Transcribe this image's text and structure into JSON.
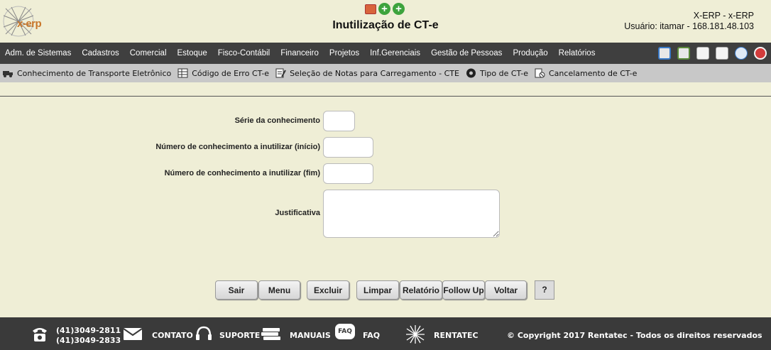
{
  "header": {
    "logo_text": "x-erp",
    "title": "Inutilização de CT-e",
    "system": "X-ERP - x-ERP",
    "user": "Usuário: itamar - 168.181.48.103"
  },
  "main_menu": [
    "Adm. de Sistemas",
    "Cadastros",
    "Comercial",
    "Estoque",
    "Fisco-Contábil",
    "Financeiro",
    "Projetos",
    "Inf.Gerenciais",
    "Gestão de Pessoas",
    "Produção",
    "Relatórios"
  ],
  "sub_menu": [
    "Conhecimento de Transporte Eletrônico",
    "Código de Erro CT-e",
    "Seleção de Notas para Carregamento - CTE",
    "Tipo de CT-e",
    "Cancelamento de CT-e"
  ],
  "form": {
    "serie_label": "Série da conhecimento",
    "numero_inicio_label": "Número de conhecimento a inutilizar (início)",
    "numero_fim_label": "Número de conhecimento a inutilizar (fim)",
    "justificativa_label": "Justificativa",
    "serie_value": "",
    "numero_inicio_value": "",
    "numero_fim_value": "",
    "justificativa_value": ""
  },
  "buttons": {
    "sair": "Sair",
    "menu": "Menu",
    "excluir": "Excluir",
    "limpar": "Limpar",
    "relatorio": "Relatório",
    "follow_up": "Follow Up",
    "voltar": "Voltar",
    "help": "?"
  },
  "footer": {
    "phone1": "(41)3049-2811",
    "phone2": "(41)3049-2833",
    "contato": "CONTATO",
    "suporte": "SUPORTE",
    "manuais": "MANUAIS",
    "faq_badge": "FAQ",
    "faq": "FAQ",
    "rentatec": "RENTATEC",
    "copyright": "© Copyright 2017 Rentatec - Todos os direitos reservados"
  }
}
